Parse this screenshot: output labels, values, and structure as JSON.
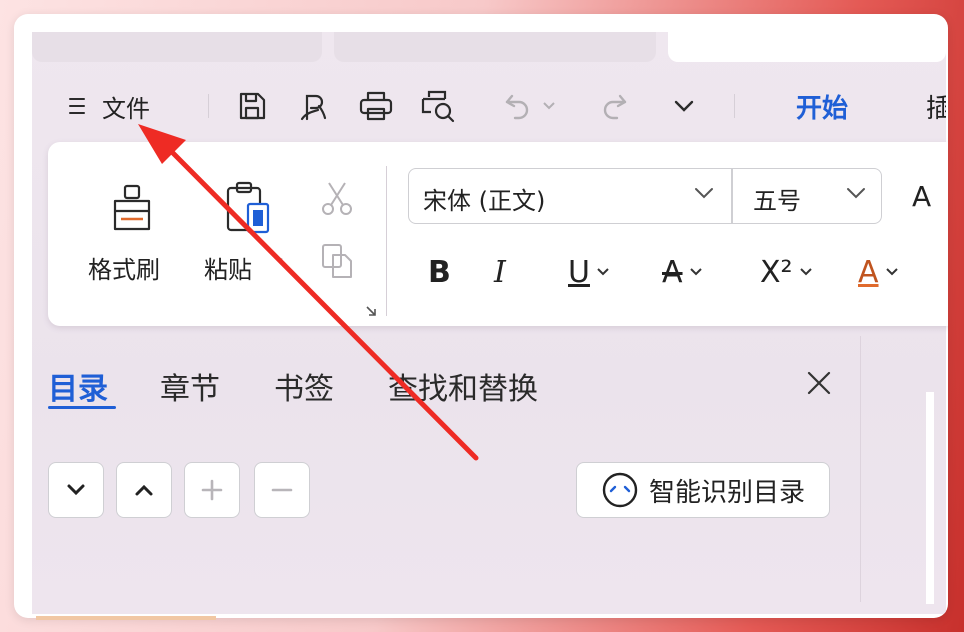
{
  "colors": {
    "accent": "#1f5fd6",
    "annotation_arrow": "#ee2b24"
  },
  "quick_access": {
    "menu_icon": "hamburger-menu-icon",
    "file_label": "文件",
    "icons": [
      "save-icon",
      "export-pdf-icon",
      "print-icon",
      "print-preview-icon",
      "undo-icon",
      "undo-dropdown-icon",
      "redo-icon",
      "more-dropdown-icon"
    ]
  },
  "ribbon_tabs": {
    "active": "开始",
    "next_partial": "插"
  },
  "clipboard": {
    "format_painter_label": "格式刷",
    "paste_label": "粘贴",
    "paste_dropdown": "·"
  },
  "font": {
    "family_value": "宋体 (正文)",
    "size_value": "五号",
    "partial_glyph": "A"
  },
  "format_buttons": {
    "bold": "B",
    "italic": "I",
    "underline": "U",
    "strikethrough": "A",
    "superscript": "X²",
    "font_color": "A"
  },
  "nav_pane": {
    "tabs": [
      "目录",
      "章节",
      "书签",
      "查找和替换"
    ],
    "active_tab": "目录",
    "smart_toc_label": "智能识别目录"
  }
}
